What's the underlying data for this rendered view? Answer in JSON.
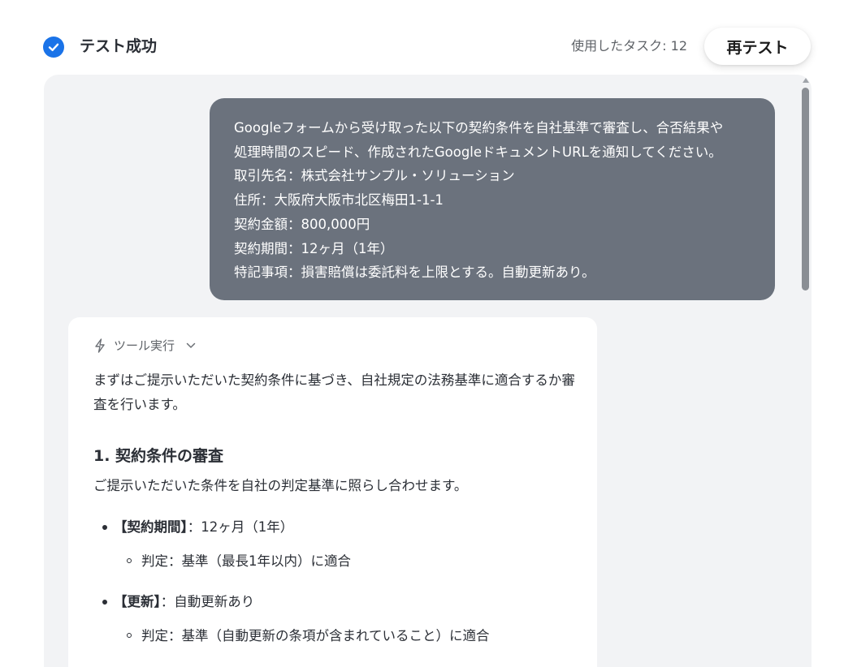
{
  "header": {
    "status_title": "テスト成功",
    "task_count": "使用したタスク: 12",
    "retest_label": "再テスト"
  },
  "user_message": {
    "lines": [
      "Googleフォームから受け取った以下の契約条件を自社基準で審査し、合否結果や",
      "処理時間のスピード、作成されたGoogleドキュメントURLを通知してください。",
      "取引先名：株式会社サンプル・ソリューション",
      "住所：大阪府大阪市北区梅田1-1-1",
      "契約金額：800,000円",
      "契約期間：12ヶ月（1年）",
      "特記事項：損害賠償は委託料を上限とする。自動更新あり。"
    ]
  },
  "assistant": {
    "tool_label": "ツール実行",
    "intro": "まずはご提示いただいた契約条件に基づき、自社規定の法務基準に適合するか審査を行います。",
    "section_heading": "1. 契約条件の審査",
    "section_desc": "ご提示いただいた条件を自社の判定基準に照らし合わせます。",
    "items": [
      {
        "label": "【契約期間】",
        "value": "：12ヶ月（1年）",
        "judgement": "判定：基準（最長1年以内）に適合"
      },
      {
        "label": "【更新】",
        "value": "：自動更新あり",
        "judgement": "判定：基準（自動更新の条項が含まれていること）に適合"
      }
    ]
  },
  "colors": {
    "accent": "#1a73e8",
    "bubble": "#6b727d",
    "panel": "#f2f3f5"
  }
}
